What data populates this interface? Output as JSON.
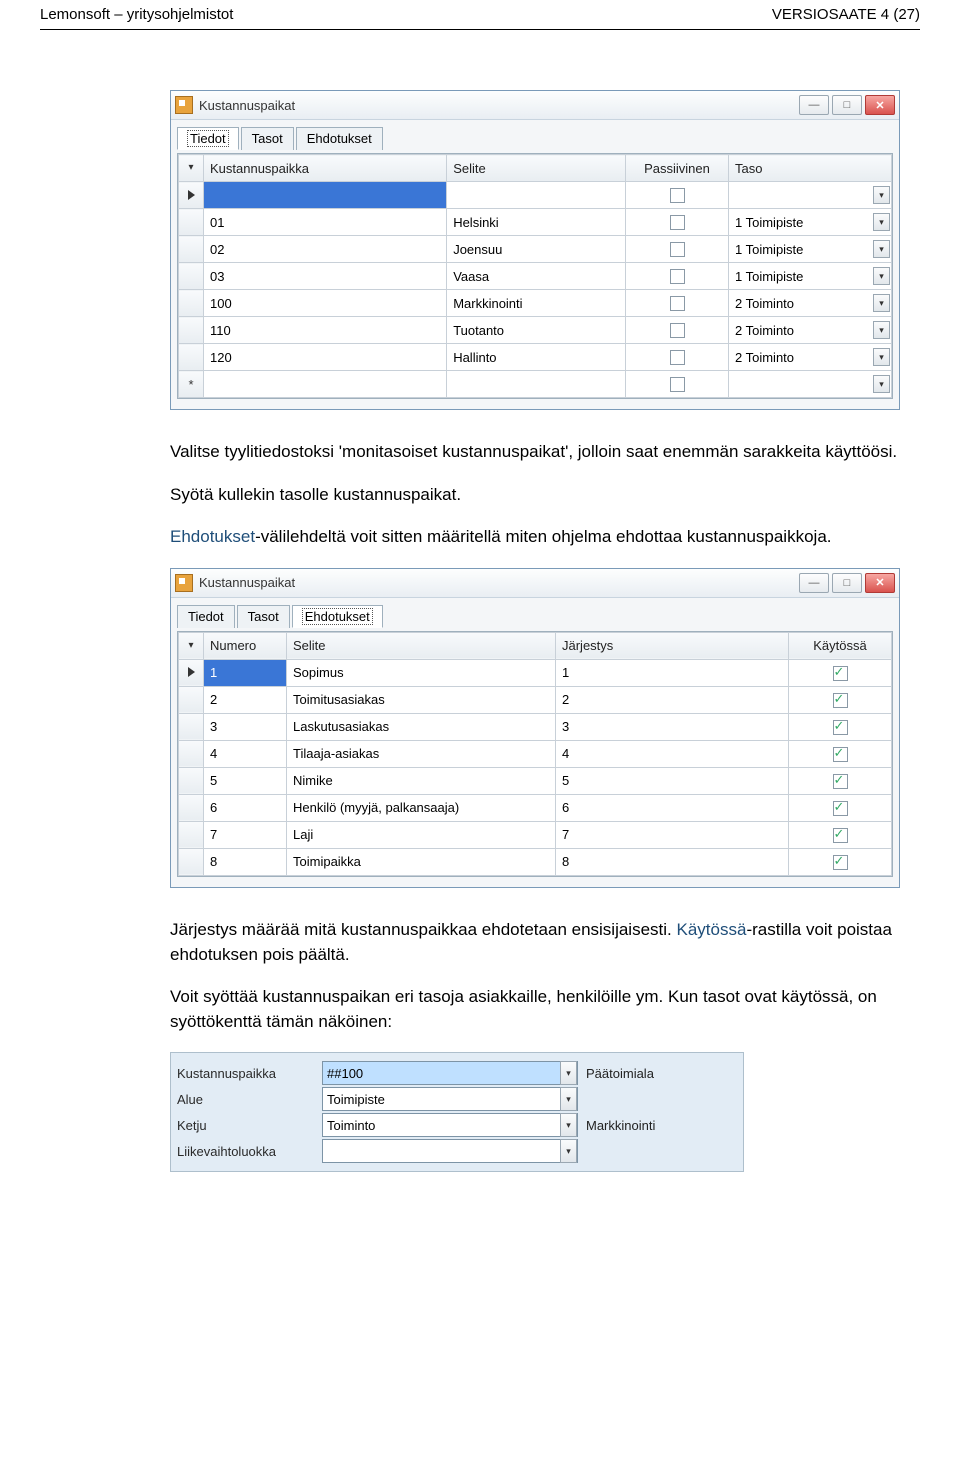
{
  "header": {
    "left": "Lemonsoft – yritysohjelmistot",
    "right": "VERSIOSAATE  4 (27)"
  },
  "window1": {
    "title": "Kustannuspaikat",
    "tabs": [
      "Tiedot",
      "Tasot",
      "Ehdotukset"
    ],
    "active_tab": 0,
    "columns": [
      "Kustannuspaikka",
      "Selite",
      "Passiivinen",
      "Taso"
    ],
    "rows": [
      {
        "code": "",
        "label": "",
        "passive": false,
        "taso": "",
        "selected": true
      },
      {
        "code": "01",
        "label": "Helsinki",
        "passive": false,
        "taso": "1 Toimipiste"
      },
      {
        "code": "02",
        "label": "Joensuu",
        "passive": false,
        "taso": "1 Toimipiste"
      },
      {
        "code": "03",
        "label": "Vaasa",
        "passive": false,
        "taso": "1 Toimipiste"
      },
      {
        "code": "100",
        "label": "Markkinointi",
        "passive": false,
        "taso": "2 Toiminto"
      },
      {
        "code": "110",
        "label": "Tuotanto",
        "passive": false,
        "taso": "2 Toiminto"
      },
      {
        "code": "120",
        "label": "Hallinto",
        "passive": false,
        "taso": "2 Toiminto"
      }
    ]
  },
  "para1": "Valitse tyylitiedostoksi 'monitasoiset kustannuspaikat', jolloin saat enemmän sarakkeita käyttöösi.",
  "para2": "Syötä kullekin tasolle kustannuspaikat.",
  "para3_blue": "Ehdotukset",
  "para3_rest": "-välilehdeltä voit sitten määritellä miten ohjelma ehdottaa kustannuspaikkoja.",
  "window2": {
    "title": "Kustannuspaikat",
    "tabs": [
      "Tiedot",
      "Tasot",
      "Ehdotukset"
    ],
    "active_tab": 2,
    "columns": [
      "Numero",
      "Selite",
      "Järjestys",
      "Käytössä"
    ],
    "rows": [
      {
        "num": "1",
        "label": "Sopimus",
        "order": "1",
        "on": true,
        "selected": true
      },
      {
        "num": "2",
        "label": "Toimitusasiakas",
        "order": "2",
        "on": true
      },
      {
        "num": "3",
        "label": "Laskutusasiakas",
        "order": "3",
        "on": true
      },
      {
        "num": "4",
        "label": "Tilaaja-asiakas",
        "order": "4",
        "on": true
      },
      {
        "num": "5",
        "label": "Nimike",
        "order": "5",
        "on": true
      },
      {
        "num": "6",
        "label": "Henkilö (myyjä, palkansaaja)",
        "order": "6",
        "on": true
      },
      {
        "num": "7",
        "label": "Laji",
        "order": "7",
        "on": true
      },
      {
        "num": "8",
        "label": "Toimipaikka",
        "order": "8",
        "on": true
      }
    ]
  },
  "para4_a": "Järjestys määrää mitä kustannuspaikkaa ehdotetaan ensisijaisesti. ",
  "para4_blue": "Käytössä",
  "para4_b": "-rastilla voit poistaa ehdotuksen pois päältä.",
  "para5": "Voit syöttää kustannuspaikan eri tasoja asiakkaille, henkilöille ym. Kun tasot ovat käytössä, on syöttökenttä tämän näköinen:",
  "form": {
    "fields": [
      {
        "label": "Kustannuspaikka",
        "value": "##100",
        "side": "Päätoimiala",
        "selected": true
      },
      {
        "label": "Alue",
        "value": "Toimipiste",
        "side": ""
      },
      {
        "label": "Ketju",
        "value": "Toiminto",
        "side": "Markkinointi"
      },
      {
        "label": "Liikevaihtoluokka",
        "value": "",
        "side": ""
      }
    ]
  }
}
